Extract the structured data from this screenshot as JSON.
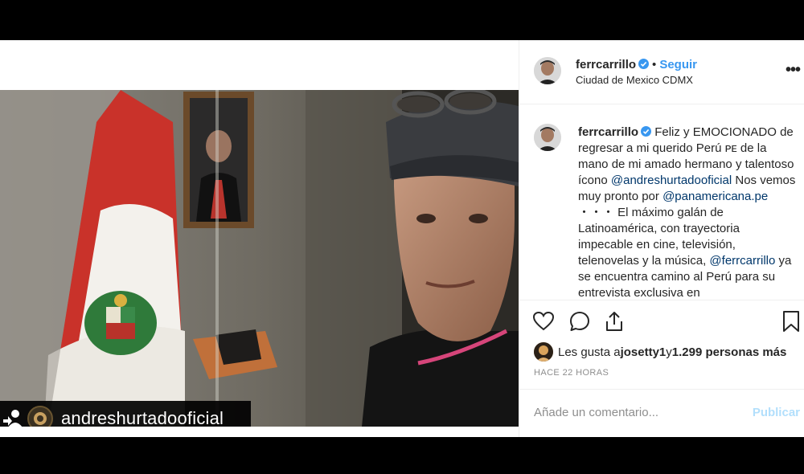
{
  "photo": {
    "repost_handle": "andreshurtadooficial"
  },
  "header": {
    "username": "ferrcarrillo",
    "separator": "•",
    "follow_label": "Seguir",
    "location": "Ciudad de Mexico CDMX",
    "more_label": "•••"
  },
  "caption": {
    "username": "ferrcarrillo",
    "text_1": "Feliz y EMOCIONADO de regresar a mi querido Perú ᴘᴇ de la mano de mi amado hermano y talentoso ícono ",
    "mention_1": "@andreshurtadooficial",
    "text_2": " Nos vemos muy pronto por ",
    "mention_2": "@panamericana.pe",
    "text_3": " ・・・ El máximo galán de Latinoamérica, con trayectoria impecable en cine, televisión, telenovelas y la música, ",
    "mention_3": "@ferrcarrillo",
    "text_4": " ya se encuentra camino al Perú para su entrevista exclusiva en"
  },
  "actions": {
    "icons": [
      "heart-icon",
      "comment-icon",
      "share-icon",
      "bookmark-icon"
    ]
  },
  "likes": {
    "prefix": "Les gusta a ",
    "user": "josetty1",
    "middle": " y ",
    "count": "1.299 personas más"
  },
  "timestamp": "HACE 22 HORAS",
  "comment": {
    "placeholder": "Añade un comentario...",
    "publish_label": "Publicar"
  },
  "colors": {
    "link": "#00376b",
    "follow": "#3897f0",
    "verified": "#3897f0",
    "publish_disabled": "#b2dffc",
    "muted": "#8e8e8e"
  }
}
